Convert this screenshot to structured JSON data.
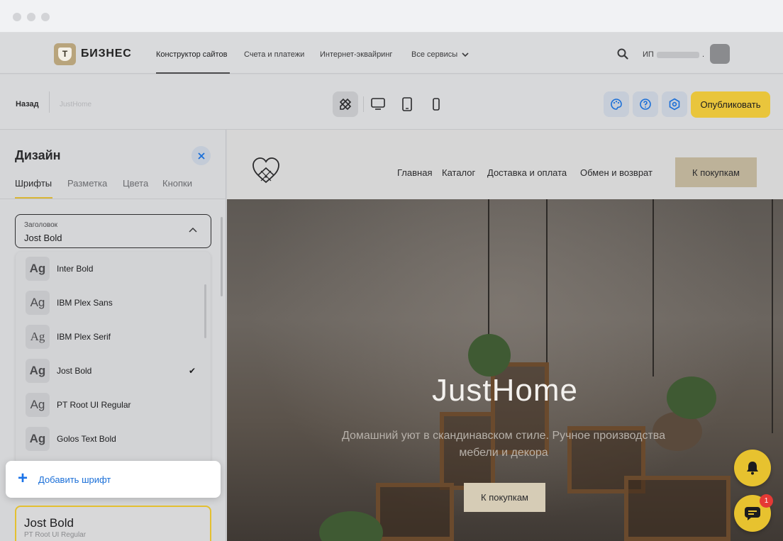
{
  "brand": {
    "logo_letter": "Т",
    "name": "БИЗНЕС"
  },
  "topnav": {
    "items": [
      "Конструктор сайтов",
      "Счета и платежи",
      "Интернет-эквайринг",
      "Все сервисы"
    ],
    "account_prefix": "ИП",
    "account_suffix": "."
  },
  "toolbar": {
    "back_label": "Назад",
    "site_name": "JustHome",
    "publish_label": "Опубликовать"
  },
  "panel": {
    "title": "Дизайн",
    "tabs": [
      "Шрифты",
      "Разметка",
      "Цвета",
      "Кнопки"
    ],
    "active_tab": "Шрифты",
    "select": {
      "label": "Заголовок",
      "value": "Jost Bold"
    },
    "fonts": [
      {
        "ag": "Ag",
        "name": "Inter Bold",
        "bold": true,
        "selected": false
      },
      {
        "ag": "Ag",
        "name": "IBM Plex Sans",
        "bold": false,
        "selected": false
      },
      {
        "ag": "Ag",
        "name": "IBM Plex Serif",
        "bold": false,
        "selected": false
      },
      {
        "ag": "Ag",
        "name": "Jost Bold",
        "bold": true,
        "selected": true
      },
      {
        "ag": "Ag",
        "name": "PT Root UI Regular",
        "bold": false,
        "selected": false
      },
      {
        "ag": "Ag",
        "name": "Golos Text Bold",
        "bold": true,
        "selected": false
      }
    ],
    "add_font_label": "Добавить шрифт",
    "preview": {
      "title": "Jost Bold",
      "subtitle": "PT Root UI Regular"
    }
  },
  "site": {
    "nav": [
      "Главная",
      "Каталог",
      "Доставка и оплата",
      "Обмен и возврат"
    ],
    "cta_label": "К покупкам",
    "hero_title": "JustHome",
    "hero_subtitle": "Домашний уют в скандинавском стиле. Ручное производства мебели и декора",
    "hero_button": "К покупкам"
  },
  "chat": {
    "badge_count": "1"
  },
  "colors": {
    "accent": "#e9c53c",
    "link": "#1a6fd8",
    "badge": "#e53935"
  }
}
